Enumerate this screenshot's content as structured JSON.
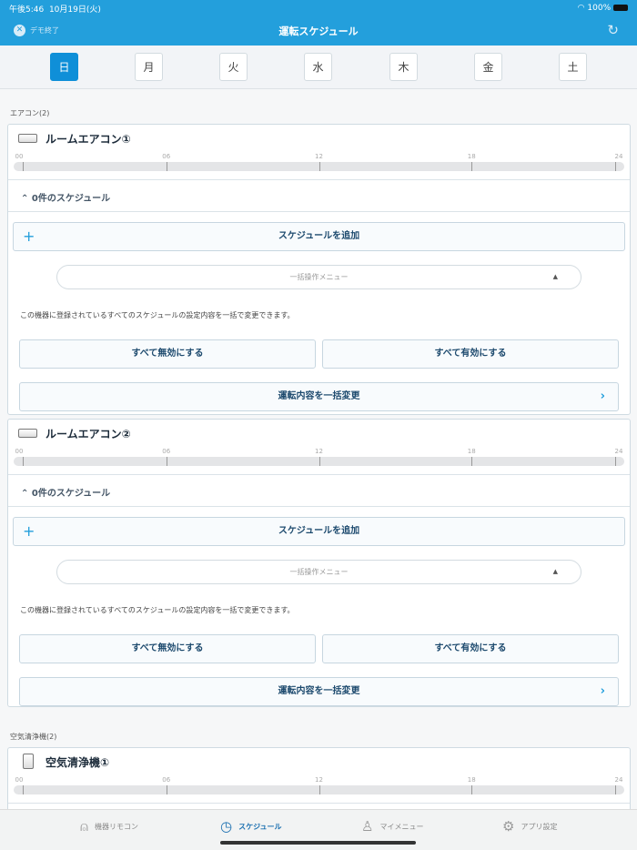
{
  "status": {
    "time": "午後5:46",
    "date": "10月19日(火)",
    "battery": "100%"
  },
  "nav": {
    "title": "運転スケジュール",
    "demo_end": "デモ終了"
  },
  "days": [
    "日",
    "月",
    "火",
    "水",
    "木",
    "金",
    "土"
  ],
  "timeline_labels": [
    "00",
    "06",
    "12",
    "18",
    "24"
  ],
  "sections": [
    {
      "label": "エアコン(2)",
      "devices": [
        {
          "name": "ルームエアコン①",
          "count": "0件のスケジュール"
        },
        {
          "name": "ルームエアコン②",
          "count": "0件のスケジュール"
        }
      ]
    },
    {
      "label": "空気清浄機(2)",
      "devices": [
        {
          "name": "空気清浄機①"
        }
      ]
    }
  ],
  "card": {
    "add": "スケジュールを追加",
    "bulk_menu": "一括操作メニュー",
    "desc": "この機器に登録されているすべてのスケジュールの設定内容を一括で変更できます。",
    "disable_all": "すべて無効にする",
    "enable_all": "すべて有効にする",
    "bulk_change": "運転内容を一括変更"
  },
  "tabs": [
    {
      "label": "機器リモコン",
      "icon": "remote-icon"
    },
    {
      "label": "スケジュール",
      "icon": "clock-icon",
      "active": true
    },
    {
      "label": "マイメニュー",
      "icon": "person-icon"
    },
    {
      "label": "アプリ設定",
      "icon": "gear-icon"
    }
  ]
}
